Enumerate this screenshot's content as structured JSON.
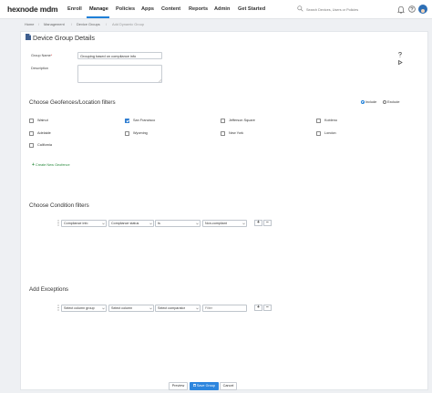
{
  "brand": {
    "logo": "hexnode mdm"
  },
  "nav": {
    "items": [
      {
        "label": "Enroll"
      },
      {
        "label": "Manage"
      },
      {
        "label": "Policies"
      },
      {
        "label": "Apps"
      },
      {
        "label": "Content"
      },
      {
        "label": "Reports"
      },
      {
        "label": "Admin"
      },
      {
        "label": "Get Started"
      }
    ],
    "active": "Manage",
    "search_placeholder": "Search Devices, Users or Policies"
  },
  "breadcrumb": [
    "Home",
    "Management",
    "Device Groups",
    "Add Dynamic Group"
  ],
  "page": {
    "title": "Device Group Details"
  },
  "form": {
    "group_name_label": "Group Name",
    "required_mark": "*",
    "group_name_value": "Grouping based on compliance info",
    "description_label": "Description",
    "description_value": ""
  },
  "geofences": {
    "title": "Choose Geofences/Location filters",
    "include_label": "Include",
    "exclude_label": "Exclude",
    "mode": "Include",
    "items": [
      {
        "label": "Walnut",
        "checked": false
      },
      {
        "label": "San Francisco",
        "checked": true
      },
      {
        "label": "Jefferson Square",
        "checked": false
      },
      {
        "label": "Kobleno",
        "checked": false
      },
      {
        "label": "Adelaide",
        "checked": false
      },
      {
        "label": "Wyoming",
        "checked": false
      },
      {
        "label": "New York",
        "checked": false
      },
      {
        "label": "London",
        "checked": false
      },
      {
        "label": "California",
        "checked": false
      }
    ],
    "create_plus": "+",
    "create_label": "Create New Geofence"
  },
  "conditions": {
    "title": "Choose Condition filters",
    "row": {
      "column_group": "Compliance info",
      "column": "Compliance status",
      "comparator": "Is",
      "value": "Non-compliant"
    },
    "add_symbol": "+",
    "remove_symbol": "−"
  },
  "exceptions": {
    "title": "Add Exceptions",
    "row": {
      "column_group": "Select column group",
      "column": "Select column",
      "comparator": "Select comparator",
      "filter_placeholder": "Filter"
    },
    "add_symbol": "+",
    "remove_symbol": "−"
  },
  "footer": {
    "preview_label": "Preview",
    "save_label": "Save Group",
    "cancel_label": "Cancel"
  },
  "colors": {
    "accent": "#1e7fd8",
    "primary_button": "#2e86de",
    "link_green": "#2a8a3e"
  }
}
